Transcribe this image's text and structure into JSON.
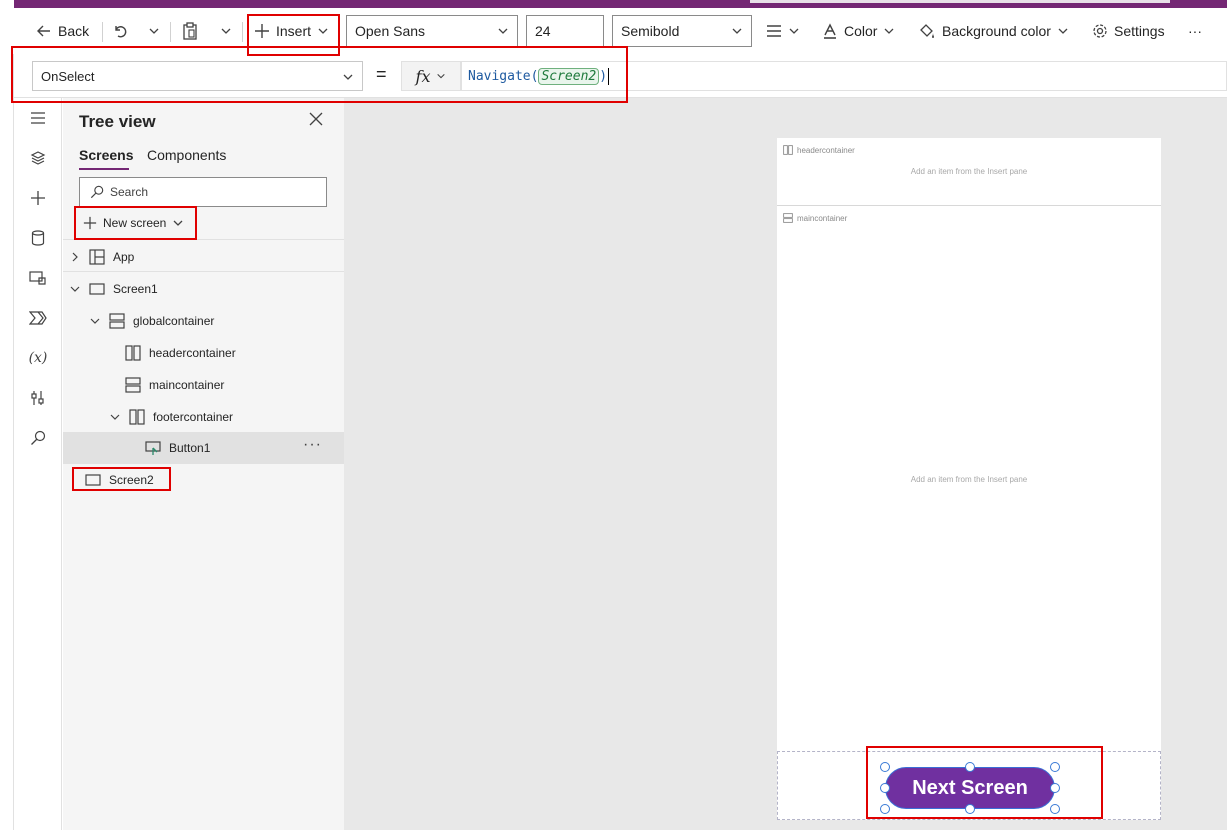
{
  "toolbar": {
    "back_label": "Back",
    "insert_label": "Insert",
    "font_value": "Open Sans",
    "font_size_value": "24",
    "font_weight_value": "Semibold",
    "color_label": "Color",
    "background_color_label": "Background color",
    "settings_label": "Settings",
    "more_label": "···"
  },
  "formula_bar": {
    "property_value": "OnSelect",
    "equals": "=",
    "fx_label": "fx",
    "function_name": "Navigate",
    "open_paren": "(",
    "argument": "Screen2",
    "close_paren": ")"
  },
  "tree_view": {
    "title": "Tree view",
    "tabs": [
      "Screens",
      "Components"
    ],
    "search_placeholder": "Search",
    "new_screen_label": "New screen",
    "nodes": {
      "app": "App",
      "screen1": "Screen1",
      "globalcontainer": "globalcontainer",
      "headercontainer": "headercontainer",
      "maincontainer": "maincontainer",
      "footercontainer": "footercontainer",
      "button1": "Button1",
      "screen2": "Screen2"
    },
    "more_label": "···"
  },
  "canvas": {
    "header_label": "headercontainer",
    "header_hint": "Add an item from the Insert pane",
    "main_label": "maincontainer",
    "main_hint": "Add an item from the Insert pane",
    "button_text": "Next Screen"
  },
  "colors": {
    "brand_purple": "#742774",
    "button_purple": "#7030a0",
    "annotation_red": "#e00000"
  }
}
